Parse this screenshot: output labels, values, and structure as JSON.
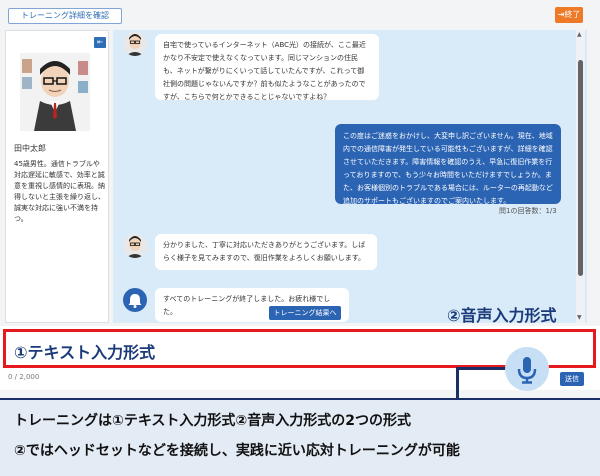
{
  "toolbar": {
    "detail_button": "トレーニング詳細を確認",
    "end_button": "終了"
  },
  "sidebar": {
    "collapse_icon": "collapse-left-icon",
    "user_name": "田中太郎",
    "user_description": "45歳男性。通信トラブルや対応遅延に敏感で、効率と誠意を重視し感情的に表現。納得しないと主張を繰り返し、誠実な対応に強い不満を持つ。"
  },
  "chat": {
    "messages": [
      {
        "role": "customer",
        "text": "自宅で使っているインターネット（ABC光）の接続が、ここ最近かなり不安定で使えなくなっています。同じマンションの住民も、ネットが繋がりにくいって話していたんですが、これって御社側の問題じゃないんですか？前も似たようなことがあったのですが、こちらで何とかできることじゃないですよね？"
      },
      {
        "role": "operator",
        "text": "この度はご迷惑をおかけし、大変申し訳ございません。現在、地域内での通信障害が発生している可能性もございますが、詳細を確認させていただきます。障害情報を確認のうえ、早急に復旧作業を行っておりますので、もう少々お時間をいただけますでしょうか。また、お客様個別のトラブルである場合には、ルーターの再起動など追加のサポートもございますのでご案内いたします。"
      },
      {
        "role": "customer",
        "text": "分かりました、丁寧に対応いただきありがとうございます。しばらく様子を見てみますので、復旧作業をよろしくお願いします。"
      },
      {
        "role": "system",
        "text": "すべてのトレーニングが終了しました。お疲れ様でした。"
      }
    ],
    "answer_count": "問1の回答数：1/3",
    "result_button": "トレーニング結果へ"
  },
  "input": {
    "text_mode_label": "①テキスト入力形式",
    "voice_mode_label": "②音声入力形式",
    "char_count": "0 / 2,000",
    "send_button": "送信",
    "mic_icon": "microphone-icon"
  },
  "caption": {
    "line1": "トレーニングは①テキスト入力形式②音声入力形式の2つの形式",
    "line2": "②ではヘッドセットなどを接続し、実践に近い応対トレーニングが可能"
  },
  "colors": {
    "accent_blue": "#2c64b4",
    "end_orange": "#ee7a28",
    "highlight_red": "#e5191e",
    "chat_bg": "#d9ebf8"
  }
}
